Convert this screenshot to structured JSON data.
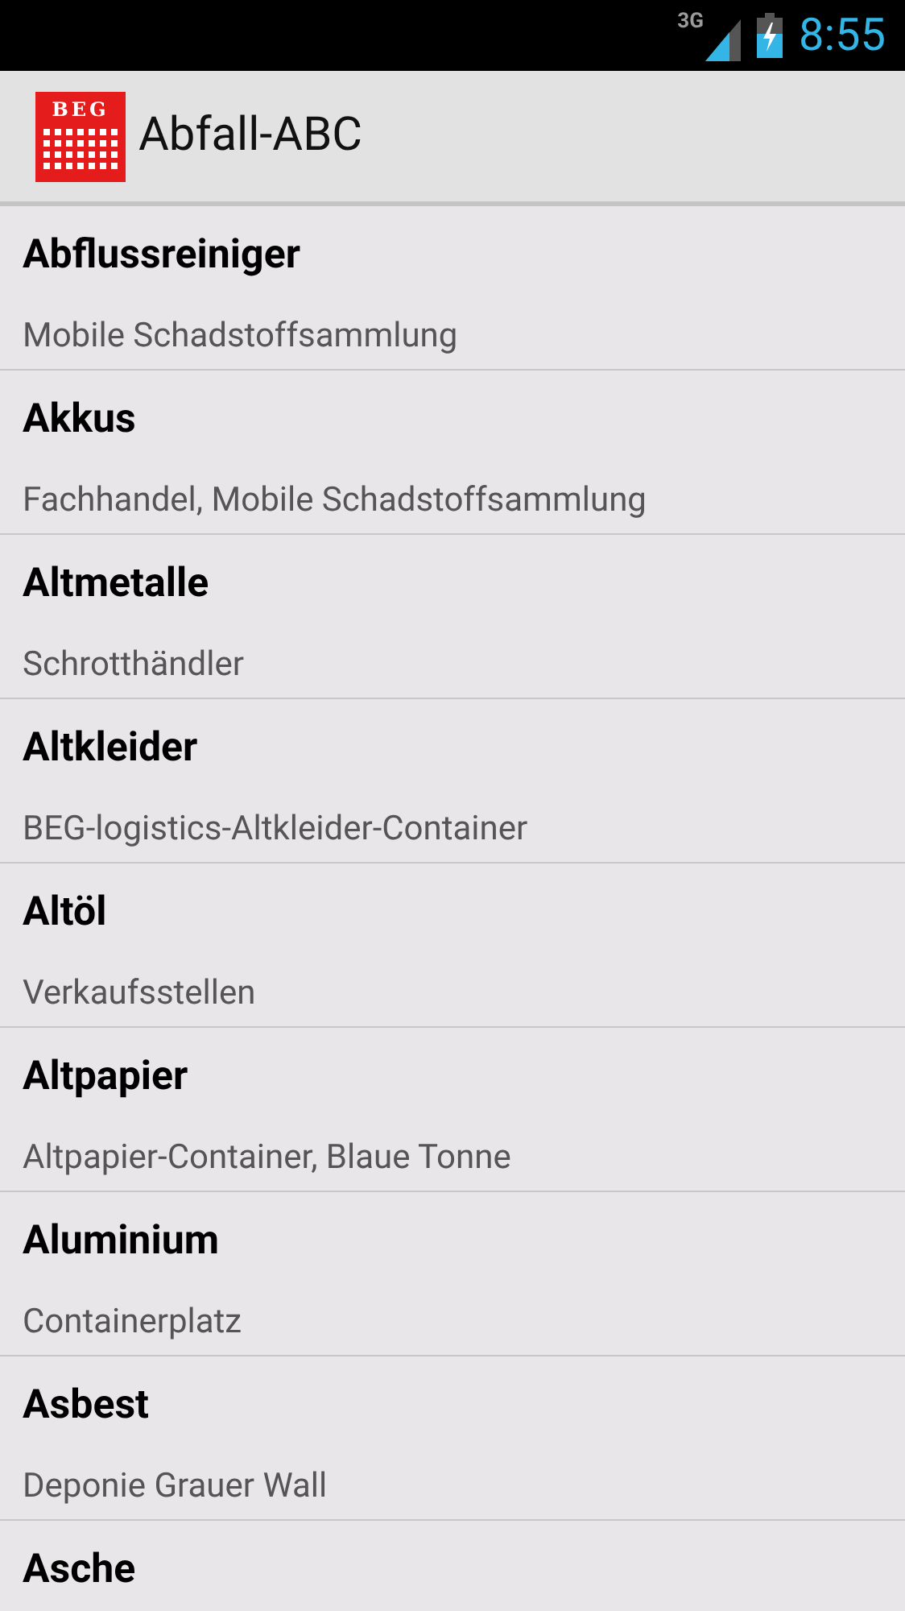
{
  "status_bar": {
    "network": "3G",
    "time": "8:55"
  },
  "app_bar": {
    "logo_text": "BEG",
    "title": "Abfall-ABC"
  },
  "items": [
    {
      "title": "Abflussreiniger",
      "subtitle": "Mobile Schadstoffsammlung"
    },
    {
      "title": "Akkus",
      "subtitle": "Fachhandel, Mobile Schadstoffsammlung"
    },
    {
      "title": "Altmetalle",
      "subtitle": "Schrotthändler"
    },
    {
      "title": "Altkleider",
      "subtitle": "BEG-logistics-Altkleider-Container"
    },
    {
      "title": "Altöl",
      "subtitle": "Verkaufsstellen"
    },
    {
      "title": "Altpapier",
      "subtitle": "Altpapier-Container, Blaue Tonne"
    },
    {
      "title": "Aluminium",
      "subtitle": "Containerplatz"
    },
    {
      "title": "Asbest",
      "subtitle": "Deponie Grauer Wall"
    },
    {
      "title": "Asche"
    }
  ]
}
